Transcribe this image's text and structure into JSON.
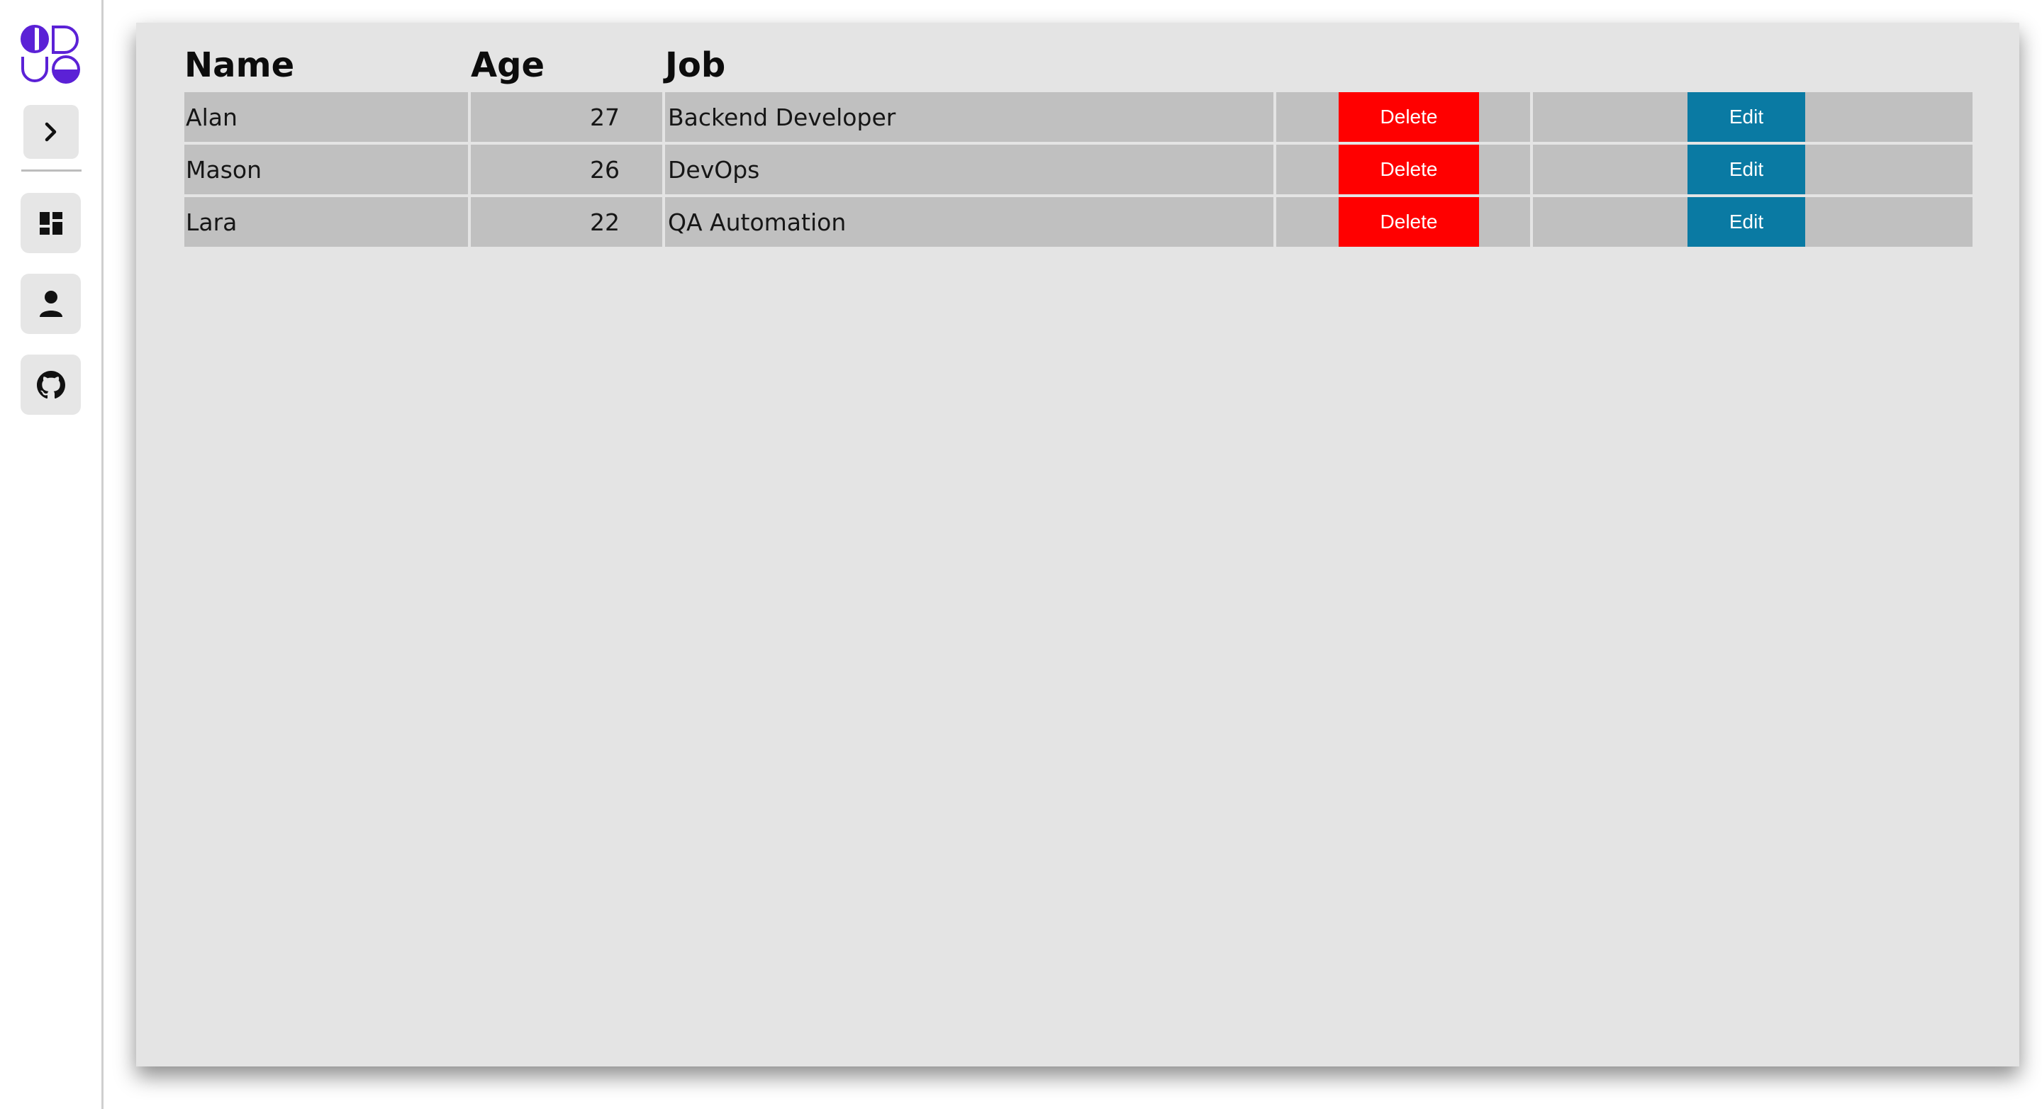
{
  "sidebar": {
    "logo_icon": "brand-logo-icon",
    "toggle_icon": "chevron-right-icon",
    "items": [
      {
        "name": "dashboard",
        "icon": "dashboard-icon"
      },
      {
        "name": "user",
        "icon": "user-icon"
      },
      {
        "name": "github",
        "icon": "github-icon"
      }
    ]
  },
  "table": {
    "headers": {
      "name": "Name",
      "age": "Age",
      "job": "Job"
    },
    "rows": [
      {
        "name": "Alan",
        "age": "27",
        "job": "Backend Developer",
        "delete_label": "Delete",
        "edit_label": "Edit"
      },
      {
        "name": "Mason",
        "age": "26",
        "job": "DevOps",
        "delete_label": "Delete",
        "edit_label": "Edit"
      },
      {
        "name": "Lara",
        "age": "22",
        "job": "QA Automation",
        "delete_label": "Delete",
        "edit_label": "Edit"
      }
    ]
  },
  "colors": {
    "brand": "#5b21d6",
    "delete": "#ff0000",
    "edit": "#0a7aa3",
    "panel": "#e4e4e4",
    "cell": "#c0c0c0"
  }
}
